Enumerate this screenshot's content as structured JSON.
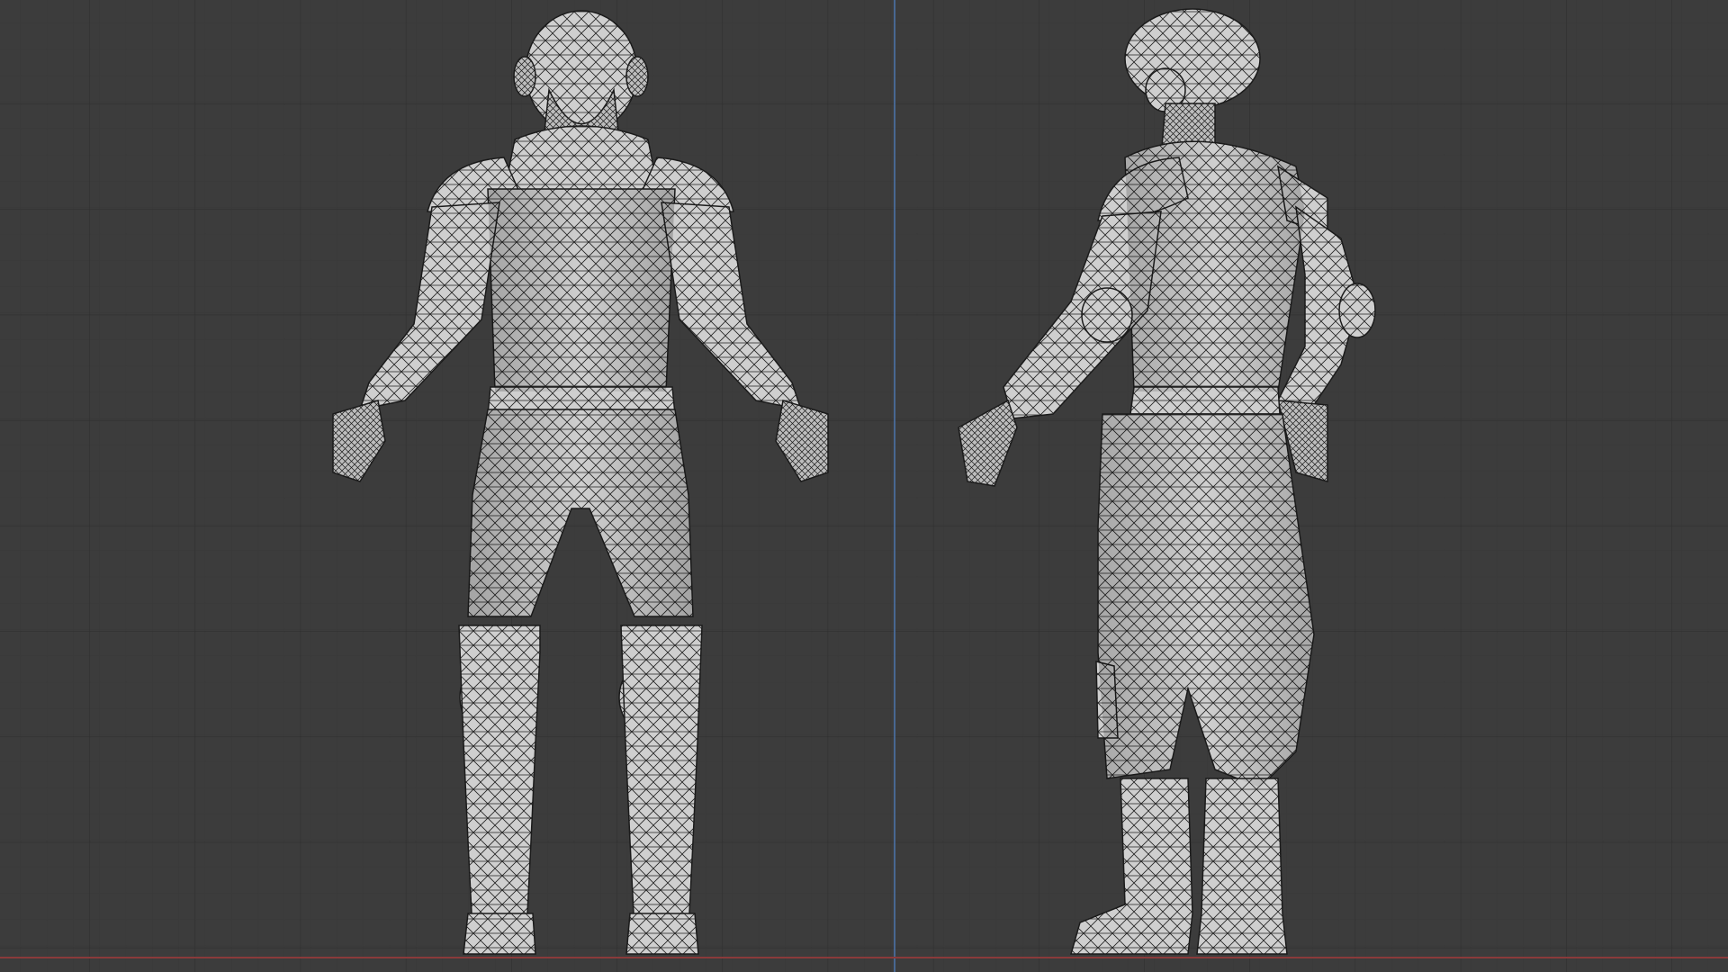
{
  "viewport": {
    "background": "#3c3c3c",
    "grid_major_color": "#2e2e2e",
    "grid_minor_color": "#363636",
    "axis_z_color": "#4a6fa0",
    "axis_x_color": "#8a3a3a"
  },
  "models": [
    {
      "view": "front",
      "mesh_color": "#cfcfcf",
      "wire_color": "#1b1b1b"
    },
    {
      "view": "back-three-quarter",
      "mesh_color": "#cfcfcf",
      "wire_color": "#1b1b1b"
    }
  ]
}
